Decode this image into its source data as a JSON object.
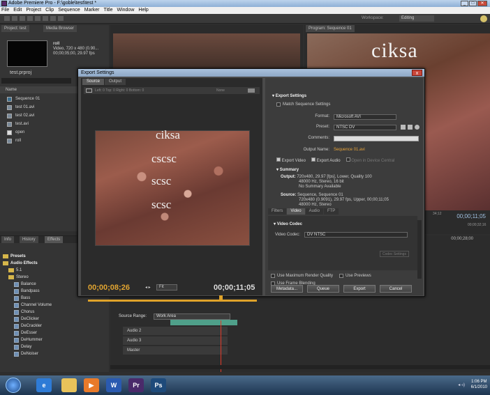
{
  "window": {
    "title": "Adobe Premiere Pro - F:\\goble\\test\\test *",
    "minimize": "_",
    "maximize": "□",
    "close": "✕"
  },
  "menu": [
    "File",
    "Edit",
    "Project",
    "Clip",
    "Sequence",
    "Marker",
    "Title",
    "Window",
    "Help"
  ],
  "workspace": {
    "label": "Workspace:",
    "value": "Editing"
  },
  "project": {
    "tabs": [
      "Project: test",
      "Media Browser"
    ],
    "clip_name": "roll",
    "clip_info": [
      "Video, 720 x 480 (0.90...",
      "00;00;05;00, 29.97 fps"
    ],
    "file": "test.prproj",
    "name_header": "Name",
    "items": [
      {
        "label": "Sequence 01",
        "kind": "seq"
      },
      {
        "label": "test 01.avi",
        "kind": "vid"
      },
      {
        "label": "test 02.avi",
        "kind": "vid"
      },
      {
        "label": "test.avi",
        "kind": "vid"
      },
      {
        "label": "open",
        "kind": "img"
      },
      {
        "label": "roll",
        "kind": "vid"
      }
    ]
  },
  "effects": {
    "tabs": [
      "Info",
      "History",
      "Effects"
    ],
    "tree": [
      {
        "label": "Presets",
        "kind": "folder",
        "bold": true,
        "indent": 0
      },
      {
        "label": "Audio Effects",
        "kind": "folder",
        "bold": true,
        "indent": 0
      },
      {
        "label": "5.1",
        "kind": "folder",
        "bold": false,
        "indent": 1
      },
      {
        "label": "Stereo",
        "kind": "folder",
        "bold": false,
        "indent": 1
      },
      {
        "label": "Balance",
        "kind": "fx",
        "bold": false,
        "indent": 2
      },
      {
        "label": "Bandpass",
        "kind": "fx",
        "bold": false,
        "indent": 2
      },
      {
        "label": "Bass",
        "kind": "fx",
        "bold": false,
        "indent": 2
      },
      {
        "label": "Channel Volume",
        "kind": "fx",
        "bold": false,
        "indent": 2
      },
      {
        "label": "Chorus",
        "kind": "fx",
        "bold": false,
        "indent": 2
      },
      {
        "label": "DeClicker",
        "kind": "fx",
        "bold": false,
        "indent": 2
      },
      {
        "label": "DeCrackler",
        "kind": "fx",
        "bold": false,
        "indent": 2
      },
      {
        "label": "DeEsser",
        "kind": "fx",
        "bold": false,
        "indent": 2
      },
      {
        "label": "DeHummer",
        "kind": "fx",
        "bold": false,
        "indent": 2
      },
      {
        "label": "Delay",
        "kind": "fx",
        "bold": false,
        "indent": 2
      },
      {
        "label": "DeNoiser",
        "kind": "fx",
        "bold": false,
        "indent": 2
      }
    ]
  },
  "program": {
    "tab": "Program: Sequence 01",
    "overlay": "ciksa",
    "timecode": "00;00;11;05",
    "ruler": [
      "34;12",
      "00;00;32;16"
    ]
  },
  "timeline": {
    "timecode_right": "00;00;28;00",
    "tracks": [
      "Audio 2",
      "Audio 3",
      "Master"
    ]
  },
  "dialog": {
    "title": "Export Settings",
    "close": "x",
    "tabs": [
      "Source",
      "Output"
    ],
    "crop_bar": "Left: 0  Top: 0  Right: 0  Bottom: 0",
    "crop_aspect": "None",
    "preview_overlays": [
      "ciksa",
      "cscsc",
      "scsc",
      "scsc"
    ],
    "timecode_current": "00;00;08;26",
    "timecode_end": "00;00;11;05",
    "step": "◂ ▸",
    "fit": "Fit",
    "source_range_label": "Source Range:",
    "source_range": "Work Area",
    "settings": {
      "header": "Export Settings",
      "match_sequence": "Match Sequence Settings",
      "format_label": "Format:",
      "format": "Microsoft AVI",
      "preset_label": "Preset:",
      "preset": "NTSC DV",
      "comments_label": "Comments:",
      "output_name_label": "Output Name:",
      "output_name": "Sequence 01.avi",
      "export_video": "Export Video",
      "export_audio": "Export Audio",
      "open_device_central": "Open in Device Central",
      "summary_header": "Summary",
      "output_label": "Output:",
      "output_lines": [
        "720x480, 29.97 [fps], Lower, Quality 100",
        "48000 Hz, Stereo, 16 bit",
        "No Summary Available"
      ],
      "source_label": "Source:",
      "source_lines": [
        "Sequence, Sequence 01",
        "720x480 (0.9091), 29.97 fps, Upper, 00;00;11;05",
        "48000 Hz, Stereo"
      ]
    },
    "right_tabs": [
      "Filters",
      "Video",
      "Audio",
      "FTP"
    ],
    "video_codec_header": "Video Codec",
    "video_codec_label": "Video Codec:",
    "video_codec": "DV NTSC",
    "codec_settings": "Codec Settings",
    "max_render": "Use Maximum Render Quality",
    "use_previews": "Use Previews",
    "frame_blending": "Use Frame Blending",
    "buttons": {
      "metadata": "Metadata...",
      "queue": "Queue",
      "export": "Export",
      "cancel": "Cancel"
    }
  },
  "taskbar": {
    "apps": [
      {
        "label": "e",
        "name": "internet-explorer-icon",
        "color": "#2e7bd6"
      },
      {
        "label": "",
        "name": "folder-icon",
        "color": "#e8c25a"
      },
      {
        "label": "▶",
        "name": "media-player-icon",
        "color": "#e87a2a"
      },
      {
        "label": "W",
        "name": "word-icon",
        "color": "#2a5ab0"
      },
      {
        "label": "Pr",
        "name": "premiere-icon",
        "color": "#4a2a6a"
      },
      {
        "label": "Ps",
        "name": "photoshop-icon",
        "color": "#1e4a7a"
      }
    ],
    "time": "1:06 PM",
    "date": "6/1/2010"
  }
}
